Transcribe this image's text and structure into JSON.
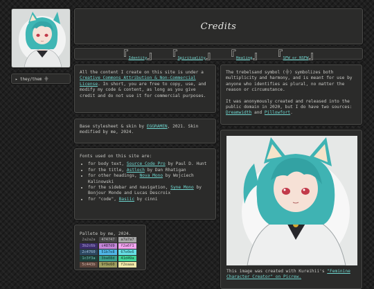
{
  "title": "Credits",
  "nav": {
    "items": [
      {
        "label": "Identity"
      },
      {
        "label": "Spirituality"
      },
      {
        "label": "Healing"
      },
      {
        "label": "SFW or NSFW"
      }
    ]
  },
  "sidebar": {
    "pronouns": "▸ they/them ⸎"
  },
  "license": {
    "before": "All the content I create on this site is under a ",
    "link": "Creative Commons Attribution & Non-Commercial License",
    "after": ". In short, you are free to copy, use, and modify my code & content, as long as you give credit and do not use it for commercial purposes."
  },
  "stylesheet": {
    "before": "Base stylesheet & skin by ",
    "link": "EGGRAMEN",
    "after": ", 2021. Skin modified by me, 2024."
  },
  "fonts": {
    "intro": "Fonts used on this site are:",
    "items": [
      {
        "pre": "for body text, ",
        "link": "Source Code Pro",
        "post": " by Paul D. Hunt"
      },
      {
        "pre": "for the title, ",
        "link": "Astloch",
        "post": " by Dan Rhatigan"
      },
      {
        "pre": "for other headings, ",
        "link": "Nova Mono",
        "post": " by Wojciech Kalinowski"
      },
      {
        "pre": "for the sidebar and navigation, ",
        "link": "Syne Mono",
        "post": " by Bonjour Monde and Lucas Descroix"
      },
      {
        "pre": "for \"code\", ",
        "link": "Basiic",
        "post": " by cinni"
      }
    ]
  },
  "palette": {
    "title": "Pallete by me, 2024.",
    "swatches": [
      {
        "hex": "2a2a2a",
        "color": "#2a2a2a",
        "text": "#9a9a9a"
      },
      {
        "hex": "474747",
        "color": "#474747",
        "text": "#bdbdbd"
      },
      {
        "hex": "a7a7a7",
        "color": "#a7a7a7",
        "text": "#2a2a2a"
      },
      {
        "hex": "3b2c6b",
        "color": "#3b2c6b",
        "text": "#b9a9e6"
      },
      {
        "hex": "c487d9",
        "color": "#c487d9",
        "text": "#2a1a33"
      },
      {
        "hex": "f2a6f1",
        "color": "#f2a6f1",
        "text": "#4a2a48"
      },
      {
        "hex": "2c4760",
        "color": "#2c4760",
        "text": "#a9c4dd"
      },
      {
        "hex": "51b7e8",
        "color": "#51b7e8",
        "text": "#10303f"
      },
      {
        "hex": "67e0e6",
        "color": "#67e0e6",
        "text": "#10383a"
      },
      {
        "hex": "1c3f3a",
        "color": "#1c3f3a",
        "text": "#7cc9bd"
      },
      {
        "hex": "3ba08d",
        "color": "#3ba08d",
        "text": "#0d2e28"
      },
      {
        "hex": "41d49a",
        "color": "#41d49a",
        "text": "#0d3526"
      },
      {
        "hex": "5c443b",
        "color": "#5c443b",
        "text": "#d8b9ad"
      },
      {
        "hex": "9f9e60",
        "color": "#9f9e60",
        "text": "#2a2a14"
      },
      {
        "hex": "f2eaaa",
        "color": "#f2eaaa",
        "text": "#4a4530"
      }
    ]
  },
  "symbol": {
    "p1": "The trebelsand symbol (⸎) symbolizes both multiplicity and harmony, and is meant for use by anyone who identifies as plural, no matter the reason or circumstance.",
    "p2_before": "It was anonymously created and released into the public domain in 2020, but I do have two sources: ",
    "link1": "Dreamwidth",
    "p2_mid": " and ",
    "link2": "Pillowfort",
    "p2_after": "."
  },
  "picture": {
    "cap_before": "This image was created with Kureihii's ",
    "cap_link": "\"Feminine Character Creator\" on Picrew."
  },
  "colors": {
    "accent": "#6fd6cf",
    "panel": "#2b2b2a",
    "background": "#1f1f1f"
  }
}
